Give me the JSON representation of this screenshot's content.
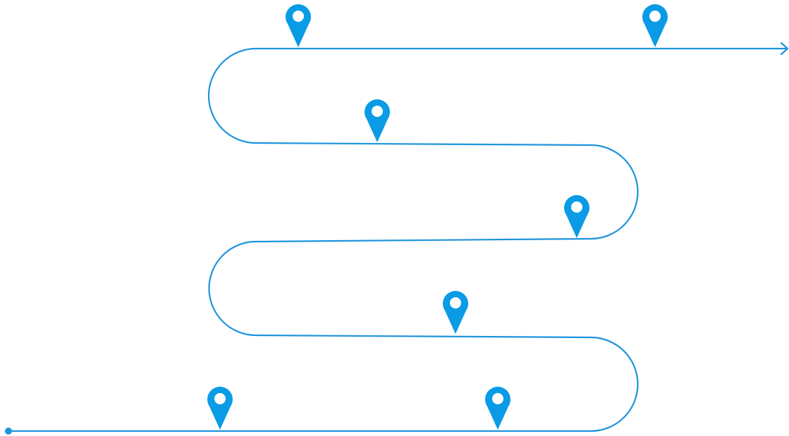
{
  "colors": {
    "route": "#1E94DC",
    "pin": "#0A9BE6",
    "pin_hole": "#ffffff",
    "background": "#ffffff"
  },
  "icons": {
    "milestone": "map-pin-icon",
    "start": "start-dot-icon",
    "end": "arrow-right-icon"
  },
  "milestones_count": 7
}
